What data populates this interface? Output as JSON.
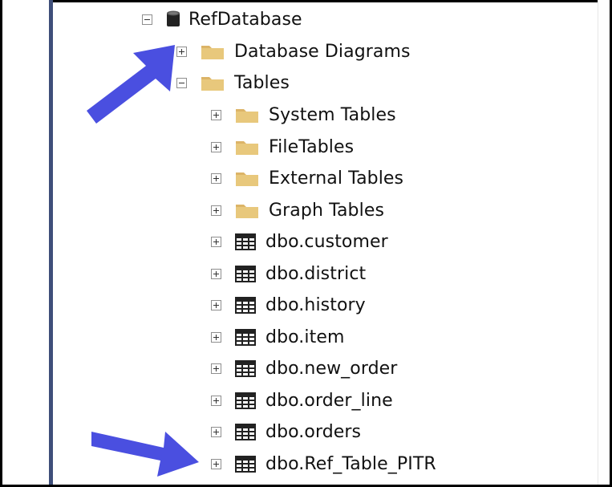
{
  "tree": {
    "root": {
      "label": "RefDatabase",
      "icon": "database-icon",
      "expanded": true
    },
    "items": [
      {
        "label": "Database Diagrams",
        "icon": "folder-icon",
        "expanded": false
      },
      {
        "label": "Tables",
        "icon": "folder-icon",
        "expanded": true
      }
    ],
    "tables": [
      {
        "label": "System Tables",
        "icon": "folder-icon",
        "expanded": false
      },
      {
        "label": "FileTables",
        "icon": "folder-icon",
        "expanded": false
      },
      {
        "label": "External Tables",
        "icon": "folder-icon",
        "expanded": false
      },
      {
        "label": "Graph Tables",
        "icon": "folder-icon",
        "expanded": false
      },
      {
        "label": "dbo.customer",
        "icon": "table-icon",
        "expanded": false
      },
      {
        "label": "dbo.district",
        "icon": "table-icon",
        "expanded": false
      },
      {
        "label": "dbo.history",
        "icon": "table-icon",
        "expanded": false
      },
      {
        "label": "dbo.item",
        "icon": "table-icon",
        "expanded": false
      },
      {
        "label": "dbo.new_order",
        "icon": "table-icon",
        "expanded": false
      },
      {
        "label": "dbo.order_line",
        "icon": "table-icon",
        "expanded": false
      },
      {
        "label": "dbo.orders",
        "icon": "table-icon",
        "expanded": false
      },
      {
        "label": "dbo.Ref_Table_PITR",
        "icon": "table-icon",
        "expanded": false
      }
    ]
  },
  "colors": {
    "arrow": "#4a4fe0",
    "folder": "#dcb467",
    "database": "#222222",
    "divider": "#3f4f7a"
  }
}
